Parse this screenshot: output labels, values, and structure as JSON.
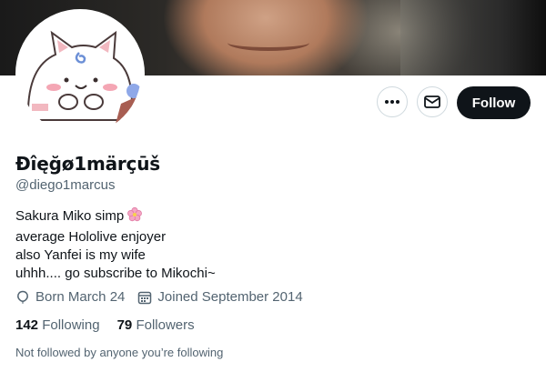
{
  "profile": {
    "display_name": "Đîęğø1märçūš",
    "handle": "@diego1marcus",
    "avatar": "cat-avatar",
    "bio_lines": [
      "Sakura Miko simp",
      "average Hololive enjoyer",
      "also Yanfei is my wife",
      "uhhh.... go subscribe to Mikochi~"
    ],
    "bio_emoji": "cherry-blossom-icon",
    "born": "Born March 24",
    "joined": "Joined September 2014",
    "following_count": "142",
    "following_label": "Following",
    "followers_count": "79",
    "followers_label": "Followers",
    "followed_note": "Not followed by anyone you’re following"
  },
  "actions": {
    "more_icon": "more-icon",
    "message_icon": "envelope-icon",
    "follow_label": "Follow"
  },
  "colors": {
    "primary_text": "#0f1419",
    "secondary_text": "#536471",
    "follow_button_bg": "#0f1419",
    "border": "#cfd9de"
  }
}
